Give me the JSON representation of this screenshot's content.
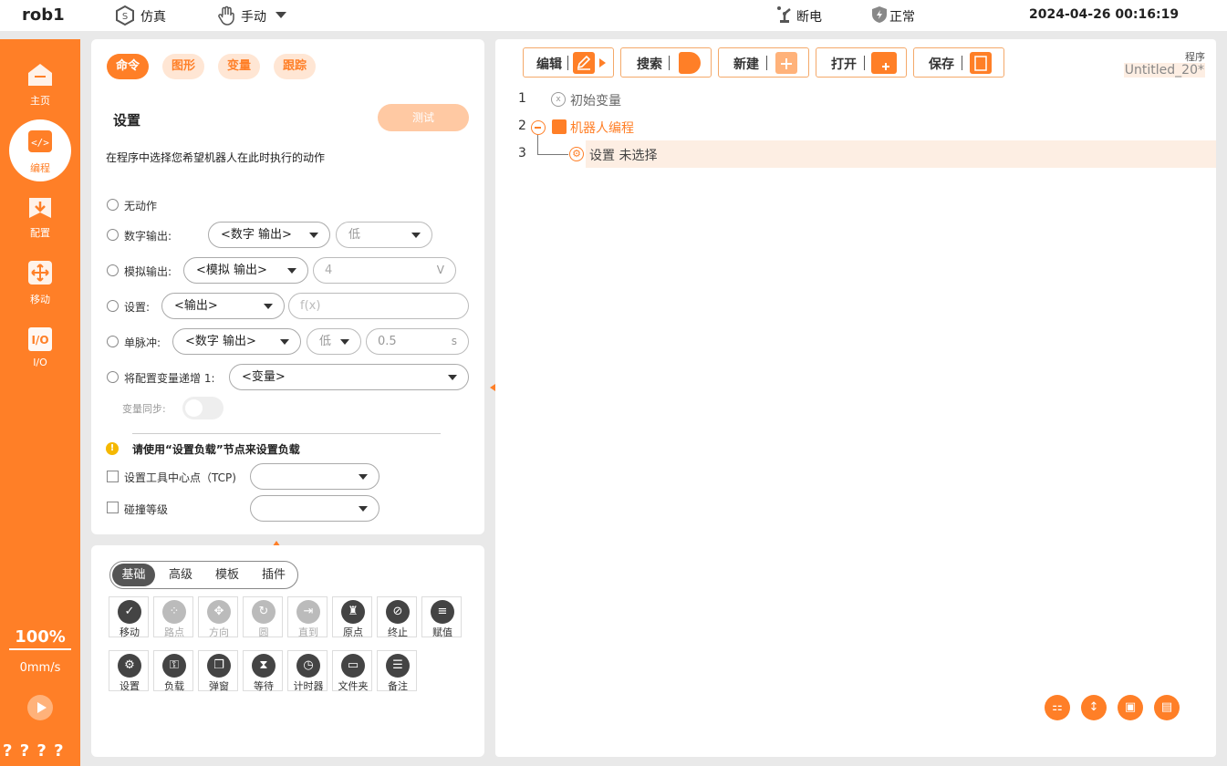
{
  "topbar": {
    "robot_name": "rob1",
    "mode_sim": "仿真",
    "mode_manual": "手动",
    "power": "断电",
    "safety": "正常",
    "datetime": "2024-04-26 00:16:19"
  },
  "sidebar": {
    "items": [
      {
        "label": "主页",
        "icon": "home-icon"
      },
      {
        "label": "编程",
        "icon": "code-icon"
      },
      {
        "label": "配置",
        "icon": "download-icon"
      },
      {
        "label": "移动",
        "icon": "move-icon"
      },
      {
        "label": "I/O",
        "icon": "io-icon"
      }
    ],
    "speed_percent": "100%",
    "speed_value": "0mm/s",
    "footer": "? ? ? ?"
  },
  "command": {
    "tabs": [
      "命令",
      "图形",
      "变量",
      "跟踪"
    ],
    "title": "设置",
    "test_button": "测试",
    "description": "在程序中选择您希望机器人在此时执行的动作",
    "options": {
      "no_action": "无动作",
      "digital_output": "数字输出:",
      "analog_output": "模拟输出:",
      "set": "设置:",
      "single_pulse": "单脉冲:",
      "increment": "将配置变量递增 1:"
    },
    "fields": {
      "digital_output_select": "<数字 输出>",
      "digital_level": "低",
      "analog_output_select": "<模拟 输出>",
      "analog_value": "4",
      "analog_unit": "V",
      "set_select": "<输出>",
      "set_expr_placeholder": "f(x)",
      "pulse_select": "<数字 输出>",
      "pulse_level": "低",
      "pulse_time": "0.5",
      "pulse_unit": "s",
      "variable_select": "<变量>"
    },
    "var_sync_label": "变量同步:",
    "info_text": "请使用“设置负载”节点来设置负载",
    "tcp_label": "设置工具中心点（TCP)",
    "collision_label": "碰撞等级"
  },
  "palette": {
    "tabs": [
      "基础",
      "高级",
      "模板",
      "插件"
    ],
    "tools_row1": [
      {
        "label": "移动",
        "icon": "move-node-icon",
        "enabled": true,
        "glyph": "✓"
      },
      {
        "label": "路点",
        "icon": "waypoint-icon",
        "enabled": false,
        "glyph": "⁘"
      },
      {
        "label": "方向",
        "icon": "direction-icon",
        "enabled": false,
        "glyph": "✥"
      },
      {
        "label": "圆",
        "icon": "circle-icon",
        "enabled": false,
        "glyph": "↻"
      },
      {
        "label": "直到",
        "icon": "until-icon",
        "enabled": false,
        "glyph": "⇥"
      },
      {
        "label": "原点",
        "icon": "origin-icon",
        "enabled": true,
        "glyph": "♜"
      },
      {
        "label": "终止",
        "icon": "stop-icon",
        "enabled": true,
        "glyph": "⊘"
      },
      {
        "label": "赋值",
        "icon": "assign-icon",
        "enabled": true,
        "glyph": "≡"
      }
    ],
    "tools_row2": [
      {
        "label": "设置",
        "icon": "gear-icon",
        "enabled": true,
        "glyph": "⚙"
      },
      {
        "label": "负载",
        "icon": "payload-icon",
        "enabled": true,
        "glyph": "⚿"
      },
      {
        "label": "弹窗",
        "icon": "popup-icon",
        "enabled": true,
        "glyph": "❐"
      },
      {
        "label": "等待",
        "icon": "hourglass-icon",
        "enabled": true,
        "glyph": "⧗"
      },
      {
        "label": "计时器",
        "icon": "timer-icon",
        "enabled": true,
        "glyph": "◷"
      },
      {
        "label": "文件夹",
        "icon": "folder-icon",
        "enabled": true,
        "glyph": "▭"
      },
      {
        "label": "备注",
        "icon": "comment-icon",
        "enabled": true,
        "glyph": "☰"
      }
    ]
  },
  "program": {
    "toolbar": [
      "编辑",
      "搜索",
      "新建",
      "打开",
      "保存"
    ],
    "label": "程序",
    "name": "Untitled_20*",
    "lines": [
      {
        "num": "1",
        "text": "初始变量"
      },
      {
        "num": "2",
        "text": "机器人编程"
      },
      {
        "num": "3",
        "text": "设置 未选择"
      }
    ]
  },
  "colors": {
    "accent": "#ff7f27",
    "accent_light": "#ffe6d4",
    "selected_row": "#fdeee3"
  }
}
